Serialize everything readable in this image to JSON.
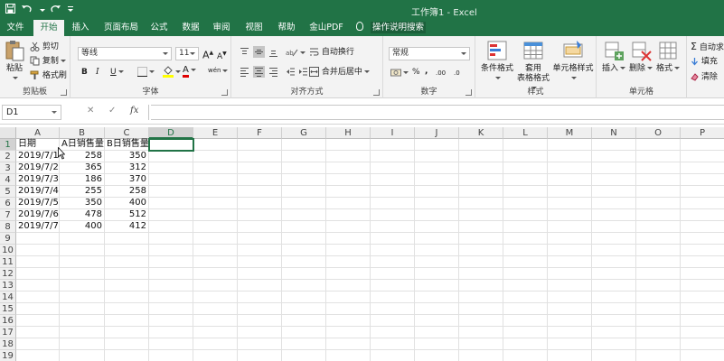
{
  "titlebar": {
    "doc_title": "工作簿1  -  Excel"
  },
  "tabs": [
    "文件",
    "开始",
    "插入",
    "页面布局",
    "公式",
    "数据",
    "审阅",
    "视图",
    "帮助",
    "金山PDF"
  ],
  "tell_me": "操作说明搜索",
  "ribbon": {
    "clipboard": {
      "label": "剪贴板",
      "paste": "粘贴",
      "cut": "剪切",
      "copy": "复制",
      "format_painter": "格式刷"
    },
    "font": {
      "label": "字体",
      "font_name": "等线",
      "font_size": "11",
      "bold": "B",
      "italic": "I",
      "underline": "U",
      "grow": "A",
      "shrink": "A",
      "font_color_letter": "A",
      "phonetic": "wén"
    },
    "alignment": {
      "label": "对齐方式",
      "wrap": "自动换行",
      "merge": "合并后居中"
    },
    "number": {
      "label": "数字",
      "format": "常规",
      "percent": "%",
      "comma": ",",
      "inc_decimal": ".00",
      "dec_decimal": ".0"
    },
    "styles": {
      "label": "样式",
      "conditional": "条件格式",
      "table_line1": "套用",
      "table_line2": "表格格式",
      "cell_styles": "单元格样式"
    },
    "cells": {
      "label": "单元格",
      "insert": "插入",
      "delete": "删除",
      "format": "格式"
    },
    "editing": {
      "autosum": "自动求",
      "fill": "填充",
      "clear": "清除"
    }
  },
  "formula_bar": {
    "name_box": "D1",
    "cancel": "✕",
    "enter": "✓",
    "fx": "fx",
    "value": ""
  },
  "sheet": {
    "columns": [
      "A",
      "B",
      "C",
      "D",
      "E",
      "F",
      "G",
      "H",
      "I",
      "J",
      "K",
      "L",
      "M",
      "N",
      "O",
      "P"
    ],
    "rows": [
      "1",
      "2",
      "3",
      "4",
      "5",
      "6",
      "7",
      "8",
      "9",
      "10",
      "11",
      "12",
      "13",
      "14",
      "15",
      "16",
      "17",
      "18",
      "19"
    ],
    "header_row": [
      "日期",
      "A日销售量",
      "B日销售量"
    ],
    "data": [
      [
        "2019/7/1",
        "258",
        "350"
      ],
      [
        "2019/7/2",
        "365",
        "312"
      ],
      [
        "2019/7/3",
        "186",
        "370"
      ],
      [
        "2019/7/4",
        "255",
        "258"
      ],
      [
        "2019/7/5",
        "350",
        "400"
      ],
      [
        "2019/7/6",
        "478",
        "512"
      ],
      [
        "2019/7/7",
        "400",
        "412"
      ]
    ],
    "selected_cell": "D1"
  },
  "colors": {
    "accent": "#217346",
    "ribbon_bg": "#f3f3f3"
  }
}
